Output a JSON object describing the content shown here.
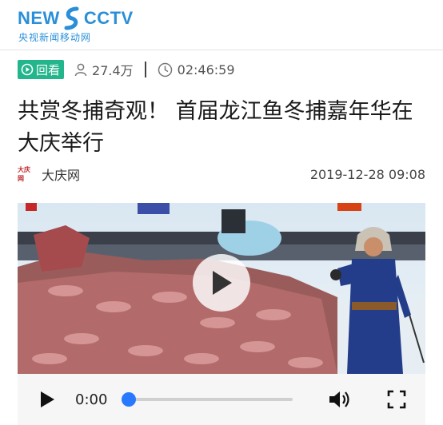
{
  "header": {
    "logo_left": "NEW",
    "logo_right": "CCTV",
    "logo_subtitle": "央视新闻移动网"
  },
  "meta": {
    "replay_label": "回看",
    "views": "27.4万",
    "duration": "02:46:59"
  },
  "article": {
    "title": "共赏冬捕奇观！ 首届龙江鱼冬捕嘉年华在大庆举行",
    "source_logo_text": "大庆网",
    "source_name": "大庆网",
    "date": "2019-12-28 09:08"
  },
  "player": {
    "current_time": "0:00",
    "progress": 0
  },
  "colors": {
    "brand_blue": "#2a8fd8",
    "replay_green": "#23b58b",
    "progress_blue": "#2979ff"
  },
  "icons": {
    "replay": "replay-icon",
    "views": "person-icon",
    "duration": "clock-icon",
    "play": "play-icon",
    "volume": "volume-icon",
    "fullscreen": "fullscreen-icon"
  }
}
